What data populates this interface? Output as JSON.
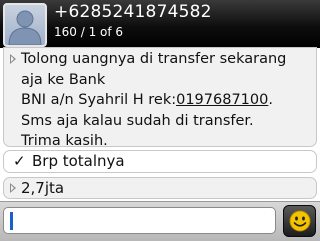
{
  "header": {
    "contact_number": "+6285241874582",
    "message_counter": "160 / 1 of 6",
    "avatar_icon": "default-contact-avatar-icon"
  },
  "messages": [
    {
      "direction": "incoming",
      "lines": [
        "Tolong uangnya di transfer sekarang",
        "aja ke Bank",
        "BNI a/n Syahril H rek:",
        "Sms aja kalau sudah di transfer.",
        "Trima kasih."
      ],
      "account_number": "0197687100",
      "account_suffix": "."
    },
    {
      "direction": "outgoing",
      "status_icon": "check-icon",
      "text": "Brp totalnya"
    },
    {
      "direction": "incoming",
      "text": "2,7jta"
    }
  ],
  "compose": {
    "value": "",
    "emoji_icon": "smiley-icon"
  },
  "colors": {
    "header_bg": "#000000",
    "bubble_incoming": "#f1f1f1",
    "bubble_outgoing": "#ffffff",
    "cursor": "#1a5fd0",
    "emoji_face": "#f5c400"
  }
}
